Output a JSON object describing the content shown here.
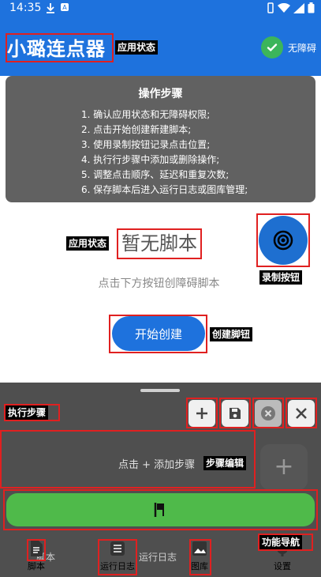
{
  "status_bar": {
    "time": "14:35"
  },
  "header": {
    "title": "小璐连点器",
    "accessibility_label": "无障碍"
  },
  "annotations": {
    "app_state": "应用状态",
    "record_button": "录制按钮",
    "create_button": "创建脚钮",
    "execute_steps": "执行步骤",
    "step_edit": "步骤编辑",
    "nav": "功能导航"
  },
  "steps_panel": {
    "title": "操作步骤",
    "items": [
      "1. 确认应用状态和无障碍权限;",
      "2. 点击开始创建新建脚本;",
      "3. 使用录制按钮记录点击位置;",
      "4. 执行行步骤中添加或删除操作;",
      "5. 调整点击顺序、延迟和重复次数;",
      "6. 保存脚本后进入运行日志或图库管理;"
    ]
  },
  "empty_state": {
    "title": "暂无脚本",
    "hint": "点击下方按钮创障碍脚本"
  },
  "create_button": {
    "label": "开始创建"
  },
  "step_editor": {
    "hint": "点击 + 添加步骤"
  },
  "bottom_nav": {
    "items": [
      {
        "label": "脚本"
      },
      {
        "label": "运行日志"
      },
      {
        "label": "图库"
      },
      {
        "label": "设置"
      }
    ],
    "bg_labels": [
      "脚本",
      "运行日志"
    ]
  },
  "colors": {
    "primary": "#1e72dd",
    "run": "#4fba4a",
    "panel": "#616161",
    "highlight": "#e02020"
  }
}
